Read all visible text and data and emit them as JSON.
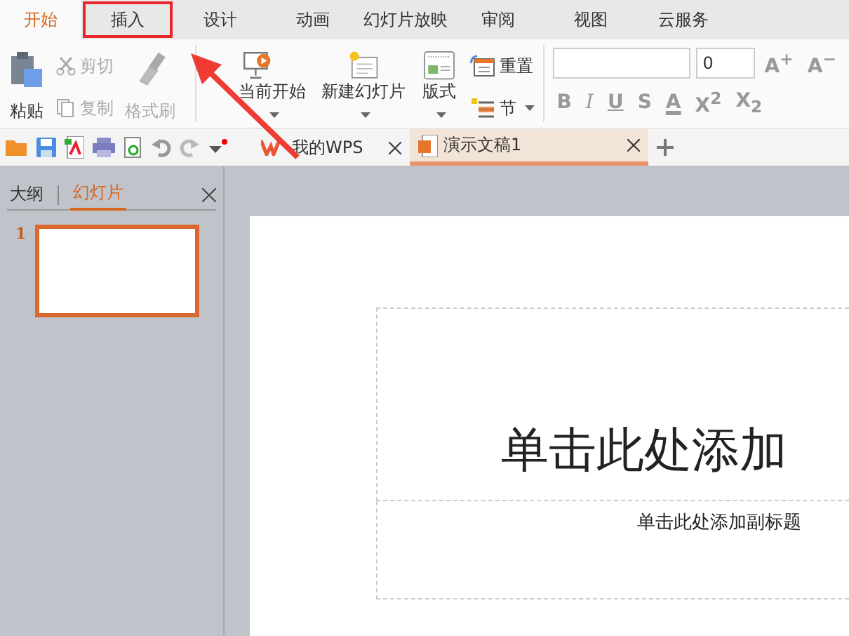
{
  "menu_tabs": [
    {
      "label": "开始",
      "selected": true,
      "highlighted": false
    },
    {
      "label": "插入",
      "selected": false,
      "highlighted": true
    },
    {
      "label": "设计",
      "selected": false,
      "highlighted": false
    },
    {
      "label": "动画",
      "selected": false,
      "highlighted": false
    },
    {
      "label": "幻灯片放映",
      "selected": false,
      "highlighted": false
    },
    {
      "label": "审阅",
      "selected": false,
      "highlighted": false
    },
    {
      "label": "视图",
      "selected": false,
      "highlighted": false
    },
    {
      "label": "云服务",
      "selected": false,
      "highlighted": false
    }
  ],
  "clipboard": {
    "paste": {
      "label": "粘贴",
      "disabled": false
    },
    "small": [
      {
        "kind": "cut",
        "label": "剪切",
        "disabled": true
      },
      {
        "kind": "copy",
        "label": "复制",
        "disabled": true
      }
    ],
    "format_painter": {
      "label": "格式刷",
      "disabled": true
    }
  },
  "slides_group": {
    "from_current": "当前开始",
    "new_slide": "新建幻灯片",
    "layout": "版式",
    "reset": "重置",
    "section": "节"
  },
  "font_group": {
    "size": "0",
    "grow": "A$^{+}$",
    "shrink": "A$^{−}$",
    "styles": [
      {
        "kind": "bold",
        "label": "B"
      },
      {
        "kind": "italic",
        "label": "I"
      },
      {
        "kind": "underline",
        "label": "U"
      },
      {
        "kind": "shadow",
        "label": "S"
      },
      {
        "kind": "color",
        "label": "A"
      },
      {
        "kind": "plain",
        "label": "X$^{2}$"
      },
      {
        "kind": "plain",
        "label": "X$_{2}$"
      }
    ]
  },
  "doc_tabs": [
    {
      "label": "我的WPS",
      "kind": "home",
      "selected": false
    },
    {
      "label": "演示文稿1",
      "kind": "doc",
      "selected": true
    }
  ],
  "sidebar": {
    "tabs": [
      {
        "label": "大纲",
        "selected": false
      },
      {
        "label": "幻灯片",
        "selected": true
      }
    ],
    "thumbnails": [
      {
        "number": "1",
        "selected": true
      }
    ]
  },
  "slide": {
    "title_placeholder": "单击此处添加",
    "subtitle_placeholder": "单击此处添加副标题"
  }
}
